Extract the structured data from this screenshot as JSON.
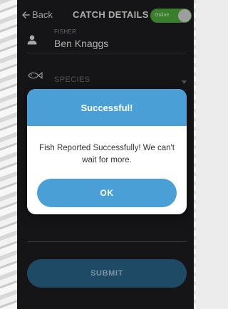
{
  "header": {
    "back_label": "Back",
    "title": "CATCH DETAILS",
    "status_toggle": {
      "label": "Online",
      "on": true
    }
  },
  "form": {
    "fisher": {
      "label": "FISHER",
      "value": "Ben Knaggs",
      "icon": "person-icon"
    },
    "species": {
      "placeholder": "SPECIES",
      "icon": "fish-icon"
    },
    "submit_label": "SUBMIT"
  },
  "dialog": {
    "title": "Successful!",
    "message": "Fish Reported Successfully! We can't wait for more.",
    "ok_label": "OK"
  },
  "colors": {
    "accent_blue": "#4a9fd6",
    "online_green": "#4caa3a",
    "app_background": "#1d1d1f"
  }
}
